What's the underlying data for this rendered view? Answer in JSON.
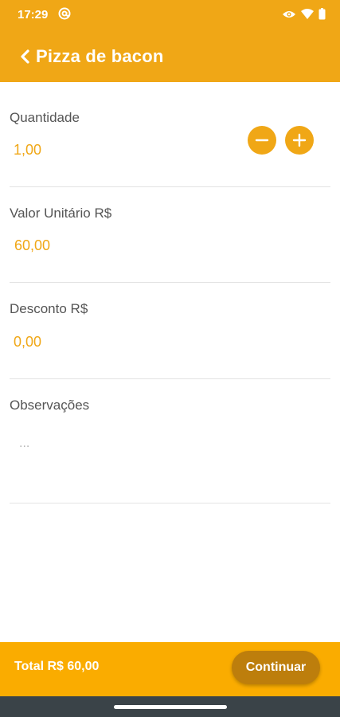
{
  "status_bar": {
    "time": "17:29",
    "icons": [
      "at-sign-icon",
      "eye-icon",
      "wifi-icon",
      "battery-icon"
    ]
  },
  "toolbar": {
    "back_icon": "chevron-left-icon",
    "title": "Pizza de bacon"
  },
  "form": {
    "quantidade": {
      "label": "Quantidade",
      "value": "1,00"
    },
    "valor_unitario": {
      "label": "Valor Unitário R$",
      "value": "60,00"
    },
    "desconto": {
      "label": "Desconto R$",
      "value": "0,00"
    },
    "observacoes": {
      "label": "Observações",
      "placeholder": "..."
    }
  },
  "footer": {
    "total": "Total R$ 60,00",
    "continue_label": "Continuar"
  },
  "colors": {
    "primary": "#F0A716",
    "footer": "#FAAC00",
    "continue_button": "#BD7E0C",
    "nav_bar": "#3a4348"
  }
}
